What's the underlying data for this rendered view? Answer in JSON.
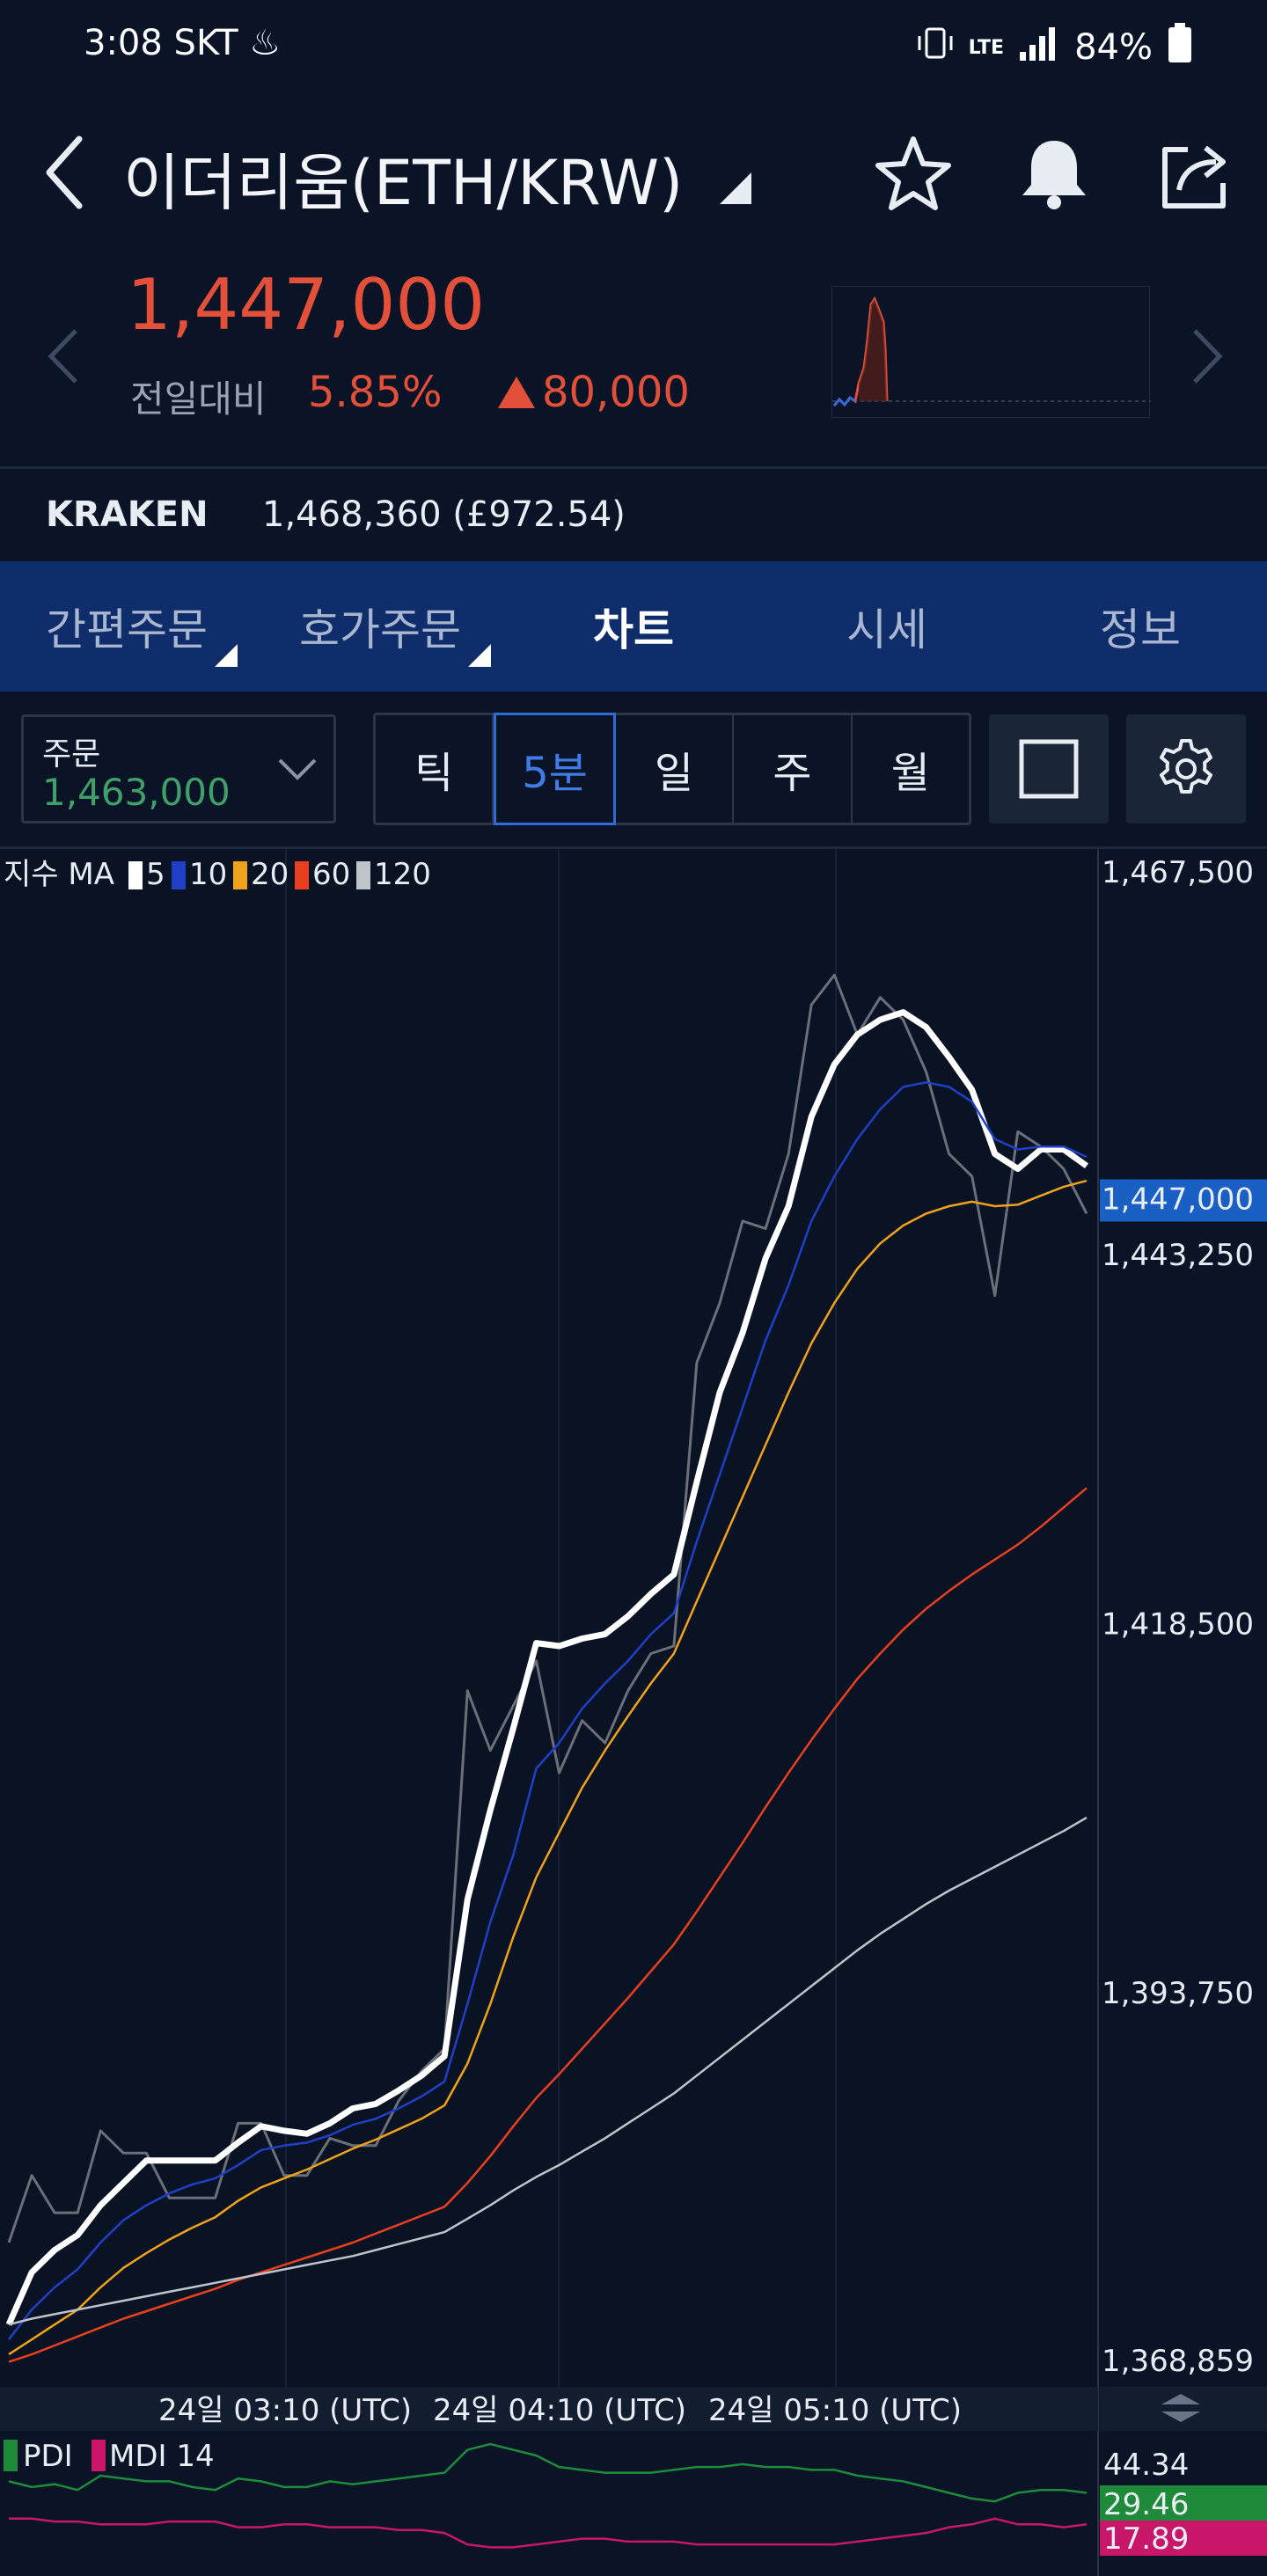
{
  "status": {
    "time": "3:08",
    "carrier": "SKT",
    "network": "LTE",
    "battery": "84%"
  },
  "header": {
    "title": "이더리움(ETH/KRW)",
    "icons": [
      "back-icon",
      "star-icon",
      "bell-icon",
      "share-icon"
    ]
  },
  "price": {
    "current": "1,447,000",
    "change_label": "전일대비",
    "change_pct": "5.85%",
    "change_abs": "80,000",
    "color": "#e2503a"
  },
  "kraken": {
    "label": "KRAKEN",
    "value": "1,468,360 (£972.54)"
  },
  "tabs": [
    {
      "label": "간편주문",
      "dropdown": true
    },
    {
      "label": "호가주문",
      "dropdown": true
    },
    {
      "label": "차트",
      "active": true
    },
    {
      "label": "시세"
    },
    {
      "label": "정보"
    }
  ],
  "order": {
    "label": "주문",
    "value": "1,463,000"
  },
  "intervals": [
    {
      "label": "틱"
    },
    {
      "label": "5분",
      "active": true
    },
    {
      "label": "일"
    },
    {
      "label": "주"
    },
    {
      "label": "월"
    }
  ],
  "chart_data": {
    "type": "line",
    "legend": {
      "prefix": "지수 MA",
      "items": [
        {
          "label": "5",
          "color": "#ffffff"
        },
        {
          "label": "10",
          "color": "#1f3fc8"
        },
        {
          "label": "20",
          "color": "#f0a21c"
        },
        {
          "label": "60",
          "color": "#e8401e"
        },
        {
          "label": "120",
          "color": "#bfc3ca"
        }
      ]
    },
    "y_ticks": [
      "1,467,500",
      "1,443,250",
      "1,418,500",
      "1,393,750",
      "1,368,859"
    ],
    "y_values": [
      1467500,
      1443250,
      1418500,
      1393750,
      1368859
    ],
    "ylim": [
      1368859,
      1467500
    ],
    "current_price_label": "1,447,000",
    "current_price": 1447000,
    "x_ticks": [
      "24일 03:10 (UTC)",
      "24일 04:10 (UTC)",
      "24일 05:10 (UTC)"
    ],
    "series": [
      {
        "name": "price",
        "color": "#6b6f78",
        "values": [
          1377000,
          1381500,
          1379000,
          1379000,
          1384500,
          1383000,
          1383000,
          1380000,
          1380000,
          1380000,
          1385000,
          1385000,
          1381500,
          1381500,
          1384000,
          1383500,
          1383500,
          1386500,
          1388500,
          1390000,
          1414000,
          1410000,
          1413000,
          1416000,
          1408500,
          1412000,
          1410500,
          1414000,
          1416500,
          1417000,
          1436000,
          1440000,
          1445500,
          1445000,
          1450000,
          1460000,
          1462000,
          1458000,
          1460500,
          1459000,
          1455500,
          1450000,
          1448500,
          1440500,
          1451500,
          1450500,
          1449000,
          1446000
        ]
      },
      {
        "name": "MA 5",
        "color": "#ffffff",
        "values": [
          1371500,
          1375000,
          1376500,
          1377500,
          1379500,
          1381000,
          1382500,
          1382500,
          1382500,
          1382500,
          1383700,
          1384800,
          1384500,
          1384300,
          1385000,
          1386000,
          1386300,
          1387200,
          1388200,
          1389500,
          1400000,
          1406000,
          1411500,
          1417200,
          1417000,
          1417500,
          1417800,
          1419000,
          1420500,
          1421800,
          1428000,
          1434000,
          1438000,
          1443000,
          1446500,
          1452500,
          1456000,
          1458000,
          1459000,
          1459500,
          1458500,
          1456500,
          1454300,
          1450000,
          1449000,
          1450300,
          1450300,
          1449200
        ]
      },
      {
        "name": "MA 10",
        "color": "#1f3fc8",
        "values": [
          1370500,
          1372500,
          1374000,
          1375200,
          1377000,
          1378500,
          1379500,
          1380300,
          1380900,
          1381300,
          1382200,
          1383200,
          1383500,
          1383700,
          1384200,
          1384900,
          1385300,
          1386000,
          1386800,
          1387800,
          1393000,
          1398500,
          1403000,
          1408800,
          1410500,
          1412800,
          1414500,
          1416000,
          1417800,
          1419200,
          1424000,
          1428500,
          1433000,
          1437500,
          1441200,
          1445500,
          1448500,
          1451000,
          1453000,
          1454500,
          1454800,
          1454500,
          1453500,
          1451000,
          1450300,
          1450500,
          1450500,
          1449800
        ]
      },
      {
        "name": "MA 20",
        "color": "#f0a21c",
        "values": [
          1369500,
          1370500,
          1371500,
          1372500,
          1374000,
          1375300,
          1376300,
          1377200,
          1378000,
          1378700,
          1379800,
          1380700,
          1381300,
          1381900,
          1382600,
          1383300,
          1383900,
          1384600,
          1385300,
          1386200,
          1389000,
          1393000,
          1397500,
          1401500,
          1404500,
          1407500,
          1410000,
          1412300,
          1414500,
          1416500,
          1420000,
          1423500,
          1427000,
          1430500,
          1434000,
          1437300,
          1440000,
          1442300,
          1444000,
          1445200,
          1446000,
          1446500,
          1446800,
          1446500,
          1446600,
          1447200,
          1447800,
          1448200
        ]
      },
      {
        "name": "MA 60",
        "color": "#e8401e",
        "values": [
          1369000,
          1369500,
          1370100,
          1370700,
          1371300,
          1371900,
          1372400,
          1372900,
          1373400,
          1373900,
          1374500,
          1375000,
          1375500,
          1376000,
          1376500,
          1377000,
          1377600,
          1378200,
          1378800,
          1379400,
          1381000,
          1382800,
          1384800,
          1386700,
          1388300,
          1390000,
          1391700,
          1393400,
          1395200,
          1397000,
          1399200,
          1401500,
          1403800,
          1406200,
          1408500,
          1410700,
          1412800,
          1414800,
          1416500,
          1418100,
          1419500,
          1420700,
          1421800,
          1422800,
          1423800,
          1425000,
          1426300,
          1427600
        ]
      },
      {
        "name": "MA 120",
        "color": "#bfc3ca",
        "values": [
          1371500,
          1371900,
          1372200,
          1372500,
          1372800,
          1373100,
          1373400,
          1373700,
          1374000,
          1374300,
          1374600,
          1374900,
          1375200,
          1375500,
          1375800,
          1376100,
          1376500,
          1376900,
          1377300,
          1377700,
          1378600,
          1379500,
          1380500,
          1381400,
          1382200,
          1383100,
          1384000,
          1385000,
          1386000,
          1387000,
          1388200,
          1389400,
          1390600,
          1391800,
          1393000,
          1394200,
          1395400,
          1396600,
          1397700,
          1398700,
          1399700,
          1400600,
          1401400,
          1402200,
          1403000,
          1403800,
          1404600,
          1405500
        ]
      }
    ]
  },
  "indicator": {
    "label_pdi": "PDI",
    "label_mdi": "MDI 14",
    "pdi_color": "#1f8a3a",
    "mdi_color": "#c8176a",
    "top_tick": "44.34",
    "pdi_value": "29.46",
    "mdi_value": "17.89",
    "pdi_series": [
      33,
      31,
      32,
      30,
      35,
      34,
      33,
      33,
      31,
      30,
      34,
      33,
      31,
      31,
      33,
      32,
      33,
      34,
      35,
      36,
      44,
      46,
      44,
      42,
      38,
      37,
      36,
      36,
      36,
      37,
      38,
      38,
      39,
      38,
      38,
      37,
      37,
      35,
      34,
      33,
      31,
      29,
      27,
      26,
      29,
      30,
      30,
      29
    ],
    "mdi_series": [
      20,
      20,
      19,
      19,
      18,
      18,
      18,
      19,
      19,
      19,
      17,
      17,
      18,
      18,
      17,
      17,
      17,
      16,
      16,
      15,
      11,
      10,
      10,
      11,
      12,
      13,
      13,
      12,
      12,
      12,
      11,
      11,
      11,
      11,
      11,
      11,
      11,
      12,
      13,
      14,
      15,
      17,
      18,
      20,
      18,
      18,
      17,
      18
    ],
    "ylim": [
      0,
      50
    ]
  }
}
